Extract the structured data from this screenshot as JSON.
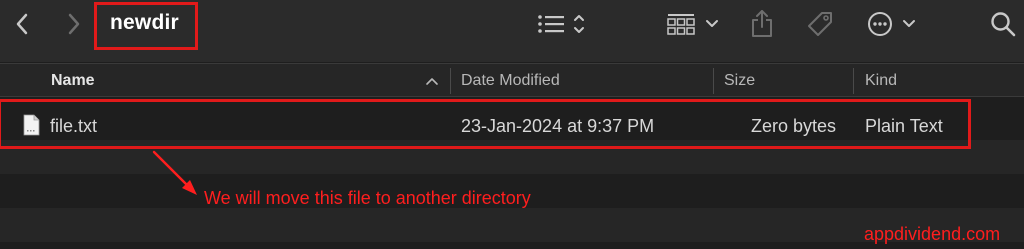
{
  "window": {
    "title": "newdir"
  },
  "toolbar": {
    "back_icon": "chevron-left-icon",
    "forward_icon": "chevron-right-icon",
    "view_options_icon": "list-view-icon",
    "group_icon": "grid-group-icon",
    "share_icon": "share-icon",
    "tag_icon": "tag-icon",
    "more_icon": "ellipsis-circle-icon",
    "search_icon": "search-icon"
  },
  "columns": [
    {
      "label": "Name"
    },
    {
      "label": "Date Modified"
    },
    {
      "label": "Size"
    },
    {
      "label": "Kind"
    }
  ],
  "files": [
    {
      "name": "file.txt",
      "date_modified": "23-Jan-2024 at 9:37 PM",
      "size": "Zero bytes",
      "kind": "Plain Text",
      "icon": "text-document-icon"
    }
  ],
  "annotation": {
    "text": "We will move this file to another directory",
    "color": "#ff1e1e"
  },
  "watermark": "appdividend.com",
  "colors": {
    "highlight": "#e11a1a",
    "background": "#1e1e1e",
    "toolbar": "#2b2b2b"
  }
}
